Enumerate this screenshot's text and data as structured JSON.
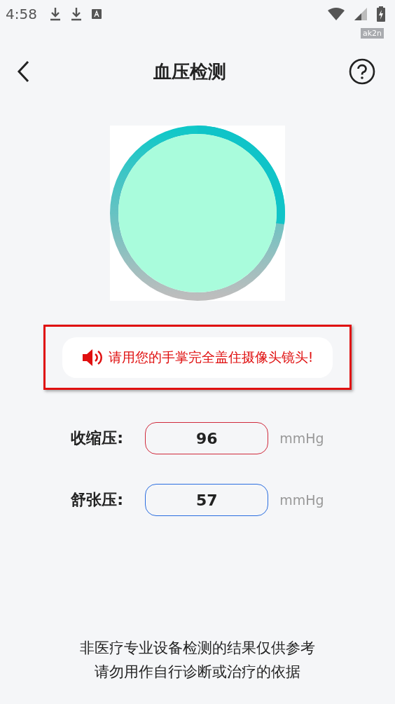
{
  "status_bar": {
    "time": "4:58",
    "badge": "ak2n"
  },
  "header": {
    "title": "血压检测"
  },
  "hint": {
    "text": "请用您的手掌完全盖住摄像头镜头!",
    "highlighted": true
  },
  "readings": [
    {
      "label": "收缩压:",
      "value": "96",
      "unit": "mmHg",
      "color": "#d02a3c"
    },
    {
      "label": "舒张压:",
      "value": "57",
      "unit": "mmHg",
      "color": "#2a6ee0"
    }
  ],
  "disclaimer": [
    "非医疗专业设备检测的结果仅供参考",
    "请勿用作自行诊断或治疗的依据"
  ]
}
